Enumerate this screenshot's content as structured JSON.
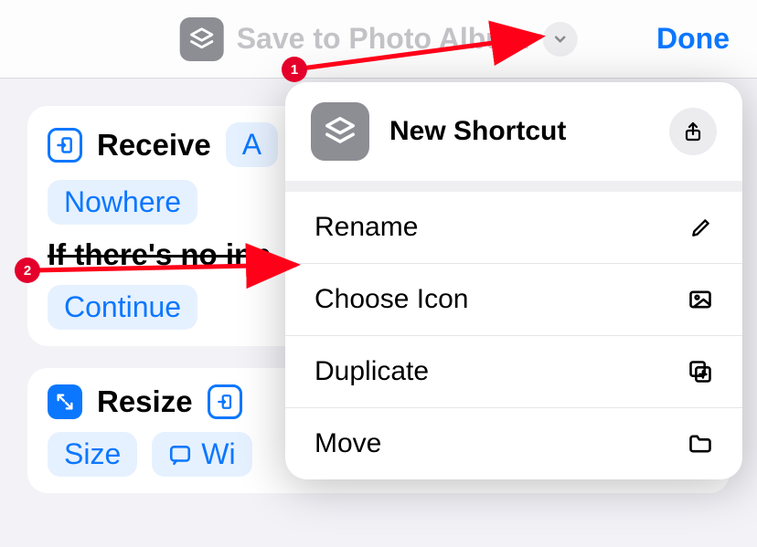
{
  "header": {
    "title": "Save to Photo Album",
    "done": "Done"
  },
  "card1": {
    "action": "Receive",
    "input_prefix": "A",
    "from_chip": "Nowhere",
    "if_line": "If there's no inp",
    "continue": "Continue"
  },
  "card2": {
    "action": "Resize",
    "size_chip": "Size",
    "wi_chip": "Wi"
  },
  "popover": {
    "title": "New Shortcut",
    "items": {
      "rename": "Rename",
      "choose_icon": "Choose Icon",
      "duplicate": "Duplicate",
      "move": "Move"
    }
  },
  "annotations": {
    "b1": "1",
    "b2": "2"
  }
}
